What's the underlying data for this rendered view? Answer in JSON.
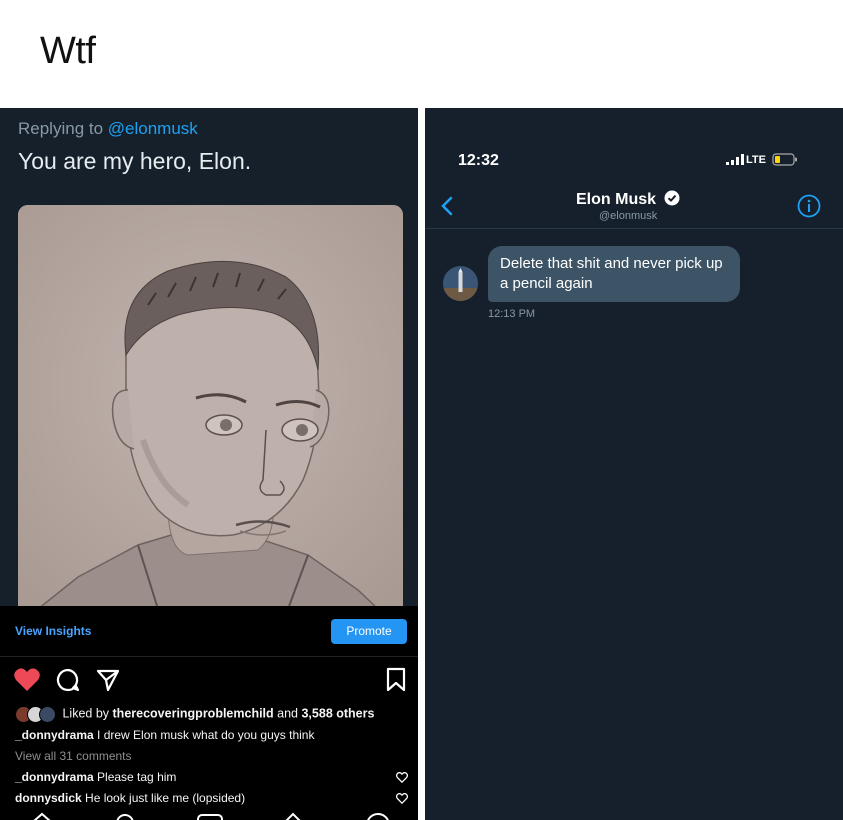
{
  "caption": "Wtf",
  "tweet": {
    "replying_prefix": "Replying to ",
    "replying_handle": "@elonmusk",
    "text": "You are my hero, Elon."
  },
  "instagram": {
    "view_insights": "View Insights",
    "promote": "Promote",
    "likes_prefix": "Liked by ",
    "likes_user": "therecoveringproblemchild",
    "likes_mid": " and ",
    "likes_count": "3,588 others",
    "caption_user": "_donnydrama",
    "caption_text": " I drew Elon musk what do you guys think",
    "view_comments": "View all 31 comments",
    "comments": [
      {
        "user": "_donnydrama",
        "text": " Please tag him"
      },
      {
        "user": "donnysdick",
        "text": " He look just like me (lopsided)"
      }
    ],
    "colors": {
      "heart": "#ed4956",
      "link": "#4aa3ff",
      "promote_bg": "#2495f3"
    }
  },
  "dm": {
    "status_time": "12:32",
    "network": "LTE",
    "contact_name": "Elon Musk",
    "contact_handle": "@elonmusk",
    "message": "Delete that shit and never pick up a pencil again",
    "message_time": "12:13 PM",
    "icons": [
      "back-chevron-icon",
      "verified-badge-icon",
      "info-icon",
      "signal-icon",
      "battery-icon"
    ],
    "colors": {
      "accent": "#1da1f2",
      "bubble": "#3d5466",
      "background": "#16202c"
    }
  }
}
